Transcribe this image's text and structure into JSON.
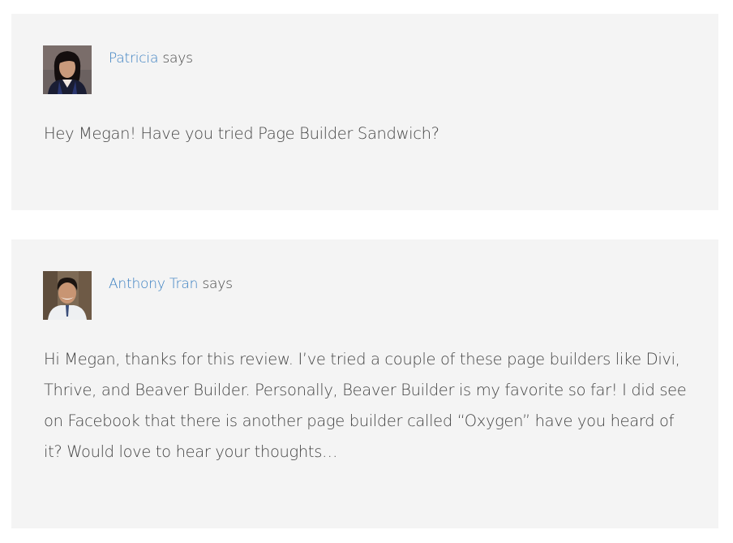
{
  "comments": [
    {
      "author": "Patricia",
      "says": "says",
      "text": "Hey Megan! Have you tried Page Builder Sandwich?"
    },
    {
      "author": "Anthony Tran",
      "says": "says",
      "text": "Hi Megan, thanks for this review. I’ve tried a couple of these page builders like Divi, Thrive, and Beaver Builder. Personally, Beaver Builder is my favorite so far! I did see on Facebook that there is another page builder called “Oxygen” have you heard of it? Would love to hear your thoughts…"
    }
  ]
}
